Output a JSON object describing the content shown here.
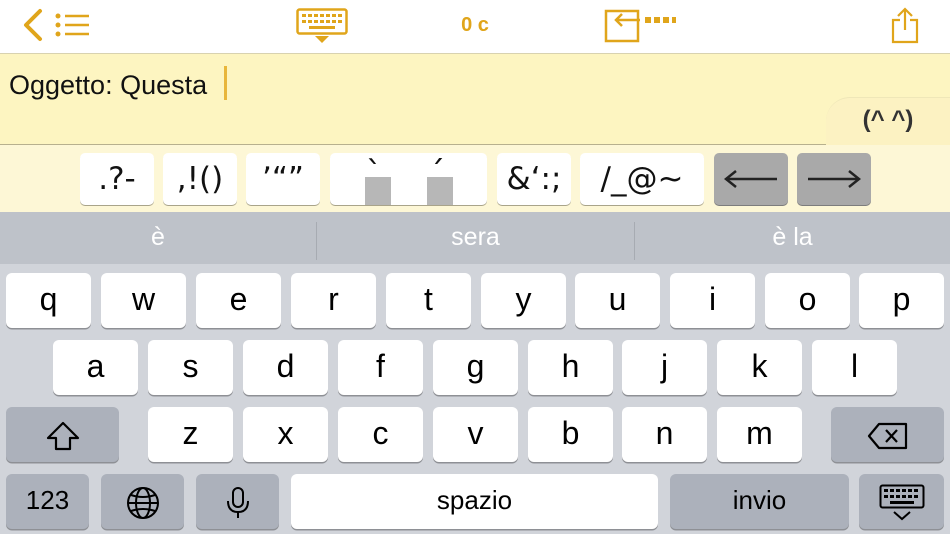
{
  "toolbar": {
    "char_count": "0 c",
    "icons": [
      "back-chevron-icon",
      "list-icon",
      "keyboard-dismiss-icon",
      "insert-text-icon",
      "share-icon"
    ]
  },
  "editor": {
    "text": "Oggetto: Questa",
    "emoticon_tab": "(^ ^)"
  },
  "symbol_bar": {
    "keys": [
      ".?-",
      ",!()",
      "’“”",
      "à é",
      "&‘:;",
      "/_@~"
    ],
    "accent_grave": "`",
    "accent_acute": "´"
  },
  "suggestions": [
    "è",
    "sera",
    "è la"
  ],
  "keyboard": {
    "row1": [
      "q",
      "w",
      "e",
      "r",
      "t",
      "y",
      "u",
      "i",
      "o",
      "p"
    ],
    "row2": [
      "a",
      "s",
      "d",
      "f",
      "g",
      "h",
      "j",
      "k",
      "l"
    ],
    "row3": [
      "z",
      "x",
      "c",
      "v",
      "b",
      "n",
      "m"
    ],
    "numbers_label": "123",
    "space_label": "spazio",
    "return_label": "invio"
  },
  "colors": {
    "accent": "#e0a51b",
    "editor_bg": "#fdf5c1",
    "keyboard_bg": "#d1d4da"
  }
}
